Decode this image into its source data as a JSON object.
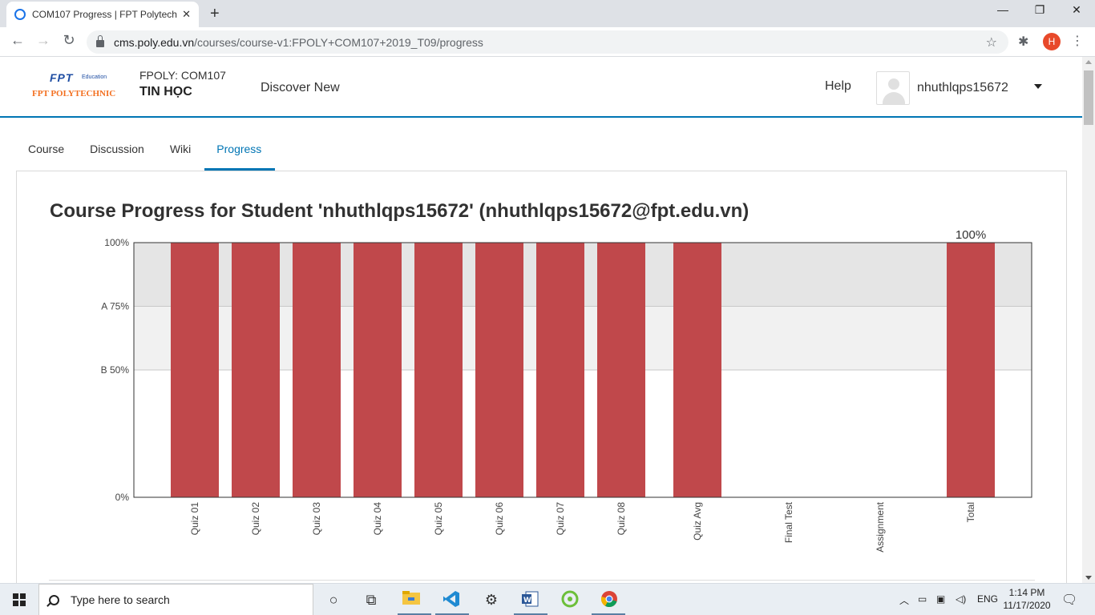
{
  "browser": {
    "tab_title": "COM107 Progress | FPT Polytechnic",
    "new_tab": "+",
    "tab_close": "✕",
    "minimize": "—",
    "restore": "❐",
    "close": "✕",
    "url_host": "cms.poly.edu.vn",
    "url_path": "/courses/course-v1:FPOLY+COM107+2019_T09/progress",
    "profile_initial": "H"
  },
  "header": {
    "logo_fpt": "FPT",
    "logo_education": "Education",
    "logo_poly": "FPT POLYTECHNIC",
    "course_org": "FPOLY: COM107",
    "course_name": "TIN HỌC",
    "discover": "Discover New",
    "help": "Help",
    "username": "nhuthlqps15672"
  },
  "course_tabs": [
    "Course",
    "Discussion",
    "Wiki",
    "Progress"
  ],
  "active_tab": "Progress",
  "page": {
    "title": "Course Progress for Student 'nhuthlqps15672' (nhuthlqps15672@fpt.edu.vn)"
  },
  "chart_data": {
    "type": "bar",
    "categories": [
      "Quiz 01",
      "Quiz 02",
      "Quiz 03",
      "Quiz 04",
      "Quiz 05",
      "Quiz 06",
      "Quiz 07",
      "Quiz 08",
      "Quiz Avg",
      "Final Test",
      "Assignment",
      "Total"
    ],
    "values": [
      100,
      100,
      100,
      100,
      100,
      100,
      100,
      100,
      100,
      0,
      0,
      100
    ],
    "ylim": [
      0,
      100
    ],
    "y_ticks": [
      {
        "value": 100,
        "label": "100%"
      },
      {
        "value": 75,
        "label": "A 75%"
      },
      {
        "value": 50,
        "label": "B 50%"
      },
      {
        "value": 0,
        "label": "0%"
      }
    ],
    "grade_bands": [
      {
        "from": 75,
        "to": 100,
        "color": "#e5e5e5"
      },
      {
        "from": 50,
        "to": 75,
        "color": "#f1f1f1"
      }
    ],
    "total_label": "100%",
    "bar_color": "#c0484b"
  },
  "taskbar": {
    "search_placeholder": "Type here to search",
    "language": "ENG",
    "time": "1:14 PM",
    "date": "11/17/2020"
  },
  "icons": {
    "start": "windows-start-icon",
    "cortana": "○",
    "taskview": "⧉",
    "settings": "⚙",
    "notifications": "🗨"
  }
}
